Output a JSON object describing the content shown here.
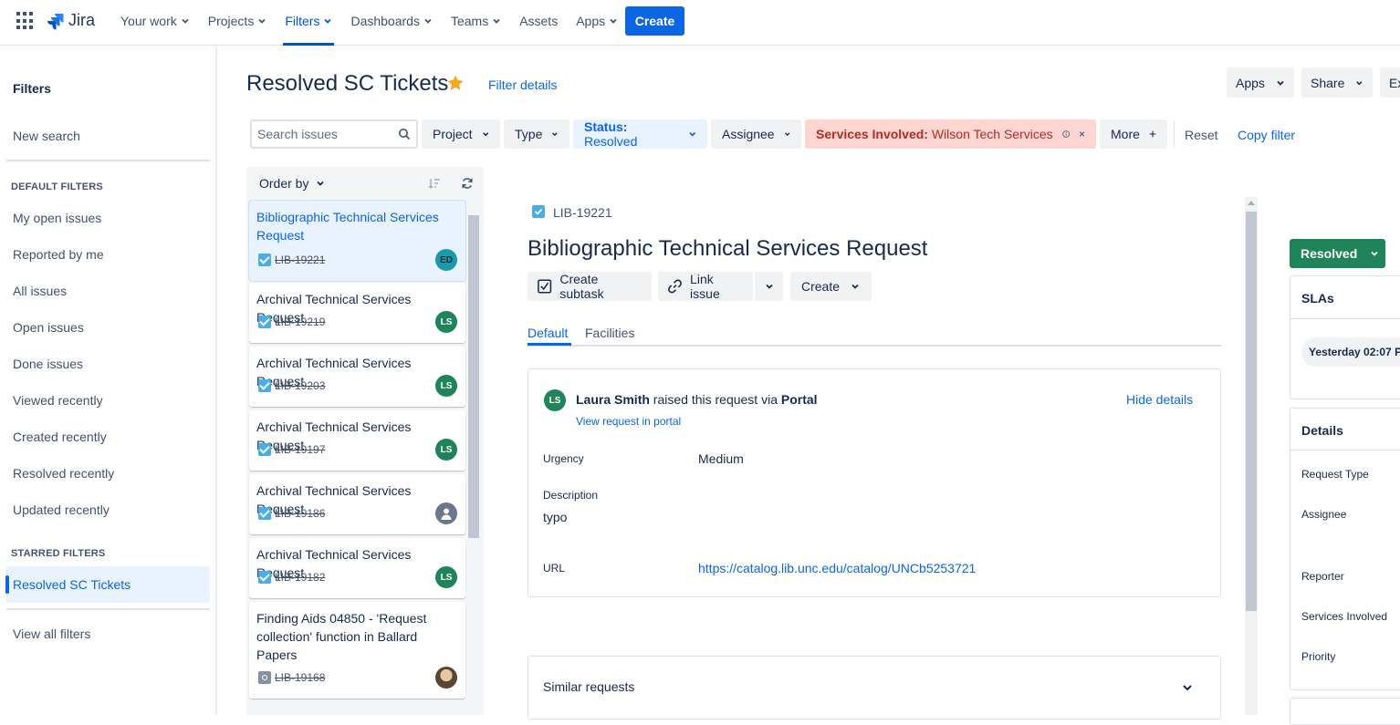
{
  "nav": {
    "logo": "Jira",
    "items": [
      {
        "label": "Your work",
        "chevron": true
      },
      {
        "label": "Projects",
        "chevron": true
      },
      {
        "label": "Filters",
        "chevron": true,
        "active": true
      },
      {
        "label": "Dashboards",
        "chevron": true
      },
      {
        "label": "Teams",
        "chevron": true
      },
      {
        "label": "Assets",
        "chevron": false
      },
      {
        "label": "Apps",
        "chevron": true
      }
    ],
    "create": "Create"
  },
  "sidebar": {
    "title": "Filters",
    "new_search": "New search",
    "default_heading": "DEFAULT FILTERS",
    "default_items": [
      "My open issues",
      "Reported by me",
      "All issues",
      "Open issues",
      "Done issues",
      "Viewed recently",
      "Created recently",
      "Resolved recently",
      "Updated recently"
    ],
    "starred_heading": "STARRED FILTERS",
    "starred_items": [
      "Resolved SC Tickets"
    ],
    "view_all": "View all filters"
  },
  "header": {
    "title": "Resolved SC Tickets",
    "filter_details": "Filter details",
    "apps": "Apps",
    "share": "Share",
    "export_partial": "Ex"
  },
  "filters": {
    "search_placeholder": "Search issues",
    "project": "Project",
    "type": "Type",
    "status_key": "Status:",
    "status_value": "Resolved",
    "assignee": "Assignee",
    "services_key": "Services Involved:",
    "services_value": "Wilson Tech Services",
    "more": "More",
    "reset": "Reset",
    "copy_filter": "Copy filter"
  },
  "list": {
    "order_by": "Order by",
    "cards": [
      {
        "title": "Bibliographic Technical Services Request",
        "key": "LIB-19221",
        "avatar": "ED",
        "avatar_kind": "ed",
        "type": "task",
        "selected": true
      },
      {
        "title": "Archival Technical Services Request",
        "key": "LIB-19219",
        "avatar": "LS",
        "avatar_kind": "ls",
        "type": "task"
      },
      {
        "title": "Archival Technical Services Request",
        "key": "LIB-19203",
        "avatar": "LS",
        "avatar_kind": "ls",
        "type": "task"
      },
      {
        "title": "Archival Technical Services Request",
        "key": "LIB-19197",
        "avatar": "LS",
        "avatar_kind": "ls",
        "type": "task"
      },
      {
        "title": "Archival Technical Services Request",
        "key": "LIB-19186",
        "avatar": "",
        "avatar_kind": "grey",
        "type": "task"
      },
      {
        "title": "Archival Technical Services Request",
        "key": "LIB-19182",
        "avatar": "LS",
        "avatar_kind": "ls",
        "type": "task"
      },
      {
        "title": "Finding Aids 04850 - 'Request collection' function in Ballard Papers",
        "key": "LIB-19168",
        "avatar": "",
        "avatar_kind": "photo",
        "type": "other"
      }
    ]
  },
  "detail": {
    "key": "LIB-19221",
    "title": "Bibliographic Technical Services Request",
    "create_subtask": "Create subtask",
    "link_issue": "Link issue",
    "create": "Create",
    "tabs": [
      "Default",
      "Facilities"
    ],
    "requester_initials": "LS",
    "requester": "Laura Smith",
    "raised_text": "raised this request via",
    "channel": "Portal",
    "view_portal": "View request in portal",
    "hide_details": "Hide details",
    "urgency_label": "Urgency",
    "urgency_value": "Medium",
    "description_label": "Description",
    "description_value": "typo",
    "url_label": "URL",
    "url_value": "https://catalog.lib.unc.edu/catalog/UNCb5253721",
    "similar": "Similar requests"
  },
  "right": {
    "status": "Resolved",
    "slas": "SLAs",
    "sla_time": "Yesterday 02:07 P",
    "details": "Details",
    "fields": [
      "Request Type",
      "Assignee",
      "Reporter",
      "Services Involved",
      "Priority"
    ]
  },
  "colors": {
    "brand": "#0c66e4",
    "resolved": "#1f845a",
    "services_bg": "#ffd5d2",
    "star": "#f5a623"
  }
}
